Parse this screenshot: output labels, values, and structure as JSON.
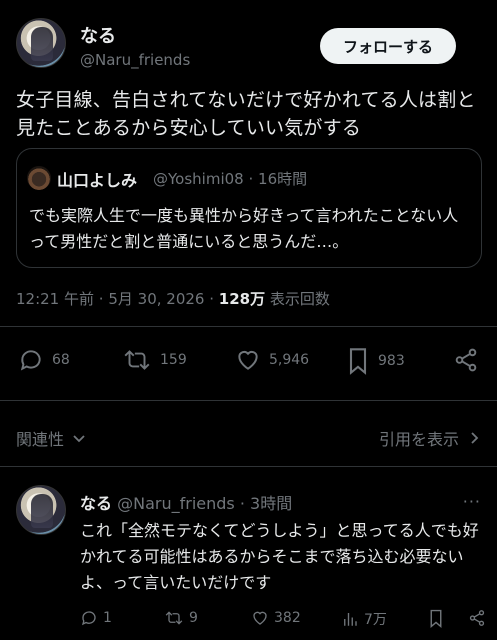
{
  "tweet": {
    "author_name": "なる",
    "author_handle": "@Naru_friends",
    "follow_label": "フォローする",
    "text": "女子目線、告白されてないだけで好かれてる人は割と見たことあるから安心していい気がする",
    "time": "12:21 午前",
    "date": "5月 30, 2026",
    "views": "128万",
    "views_label": "表示回数",
    "dot": "·"
  },
  "quote": {
    "author_name": "山口よしみ",
    "author_handle": "@Yoshimi08",
    "ago": "16時間",
    "text": "でも実際人生で一度も異性から好きって言われたことない人って男性だと割と普通にいると思うんだ…。"
  },
  "actions": {
    "replies": "68",
    "retweets": "159",
    "likes": "5,946",
    "bookmarks": "983"
  },
  "filter": {
    "relevance": "関連性",
    "view_quotes": "引用を表示"
  },
  "reply": {
    "author_name": "なる",
    "author_handle": "@Naru_friends",
    "ago": "3時間",
    "more": "···",
    "text": "これ「全然モテなくてどうしよう」と思ってる人でも好かれてる可能性はあるからそこまで落ち込む必要ないよ、って言いたいだけです",
    "replies": "1",
    "retweets": "9",
    "likes": "382",
    "views": "7万"
  },
  "colors": {
    "background": "#000000",
    "text": "#e7e9ea",
    "muted": "#71767b",
    "border": "#2f3336",
    "follow_bg": "#eff3f4"
  }
}
